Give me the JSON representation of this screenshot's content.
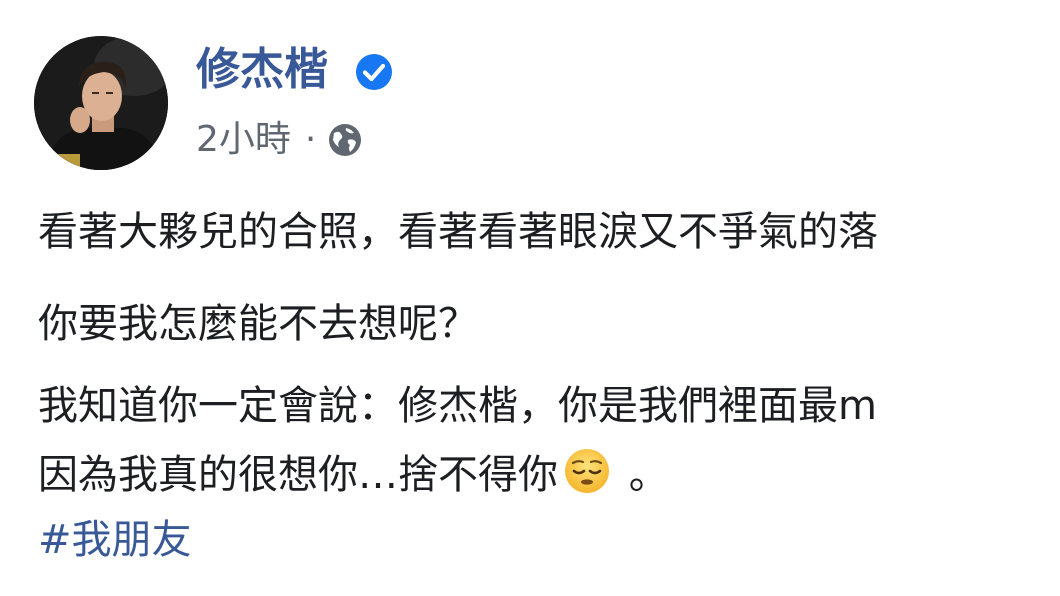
{
  "post": {
    "author": {
      "name": "修杰楷",
      "verified": true,
      "avatar": "profile-photo"
    },
    "meta": {
      "timestamp": "2小時",
      "separator": "·",
      "audience_icon": "globe-icon"
    },
    "body": {
      "line1": "看著大夥兒的合照，看著看著眼淚又不爭氣的落",
      "line2": "你要我怎麼能不去想呢？",
      "line3": "我知道你一定會說：修杰楷，你是我們裡面最m",
      "line4_text": "因為我真的很想你…捨不得你",
      "line4_emoji": "relieved-face-emoji",
      "line4_end": " 。"
    },
    "hashtag": "#我朋友"
  },
  "colors": {
    "link_blue": "#385898",
    "text": "#1c1e21",
    "meta_gray": "#606770",
    "verified_blue": "#1877f2"
  }
}
